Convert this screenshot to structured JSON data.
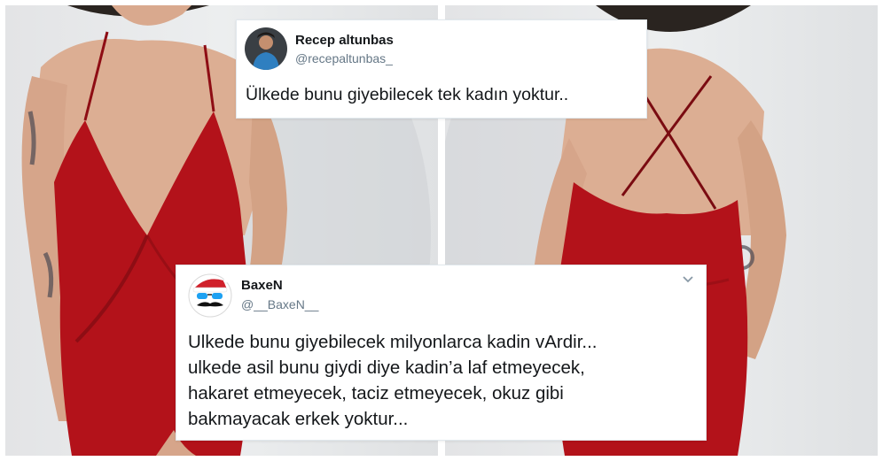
{
  "colors": {
    "dress": "#b3121a",
    "card_border": "#e1e8ed",
    "handle": "#657786"
  },
  "photos": [
    {
      "name": "woman-red-dress-front"
    },
    {
      "name": "woman-red-dress-back"
    }
  ],
  "tweets": [
    {
      "author": "Recep altunbas",
      "handle": "@recepaltunbas_",
      "avatar_icon": "profile-photo",
      "text": "Ülkede bunu giyebilecek tek kadın yoktur.."
    },
    {
      "author": "BaxeN",
      "handle": "@__BaxeN__",
      "avatar_icon": "santa-hat-mustache-sunglasses-avatar",
      "menu_icon": "chevron-down-icon",
      "text": "Ulkede bunu giyebilecek milyonlarca kadin vArdir...\nulkede asil bunu giydi diye kadin’a laf etmeyecek,\nhakaret etmeyecek, taciz etmeyecek, okuz gibi\nbakmayacak erkek yoktur..."
    }
  ]
}
